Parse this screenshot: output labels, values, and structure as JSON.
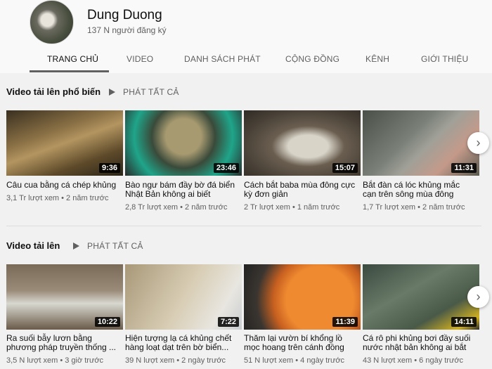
{
  "channel": {
    "name": "Dung Duong",
    "subscribers": "137 N người đăng ký"
  },
  "tabs": [
    "TRANG CHỦ",
    "VIDEO",
    "DANH SÁCH PHÁT",
    "CỘNG ĐỒNG",
    "KÊNH",
    "GIỚI THIỆU"
  ],
  "active_tab": "TRANG CHỦ",
  "sections": [
    {
      "title": "Video tải lên phổ biến",
      "play_all": "PHÁT TẤT CẢ",
      "videos": [
        {
          "title": "Câu cua bằng cá chép khủng",
          "duration": "9:36",
          "meta": "3,1 Tr lượt xem • 2 năm trước"
        },
        {
          "title": "Bào ngư bám đầy bờ đá biển Nhật Bản không ai biết",
          "duration": "23:46",
          "meta": "2,8 Tr lượt xem • 2 năm trước"
        },
        {
          "title": "Cách bắt baba mùa đông cực kỳ đơn giản",
          "duration": "15:07",
          "meta": "2 Tr lượt xem • 1 năm trước"
        },
        {
          "title": "Bắt đàn cá lóc khủng mắc cạn trên sông mùa đông",
          "duration": "11:31",
          "meta": "1,7 Tr lượt xem • 2 năm trước"
        }
      ]
    },
    {
      "title": "Video tải lên",
      "play_all": "PHÁT TẤT CẢ",
      "videos": [
        {
          "title": "Ra suối bẫy lươn bằng phương pháp truyền thống ...",
          "duration": "10:22",
          "meta": "3,5 N lượt xem • 3 giờ trước"
        },
        {
          "title": "Hiện tượng lạ cá khủng chết hàng loạt dạt trên bờ biển...",
          "duration": "7:22",
          "meta": "39 N lượt xem • 2 ngày trước"
        },
        {
          "title": "Thăm lại vườn bí khổng lồ mọc hoang trên cánh đồng",
          "duration": "11:39",
          "meta": "51 N lượt xem • 4 ngày trước"
        },
        {
          "title": "Cá rô phi khủng bơi đầy suối nước nhật bản không ai bắt",
          "duration": "14:11",
          "meta": "43 N lượt xem • 6 ngày trước"
        }
      ]
    }
  ],
  "icons": {
    "next": "chevron-right-icon",
    "play_all": "play-icon"
  }
}
